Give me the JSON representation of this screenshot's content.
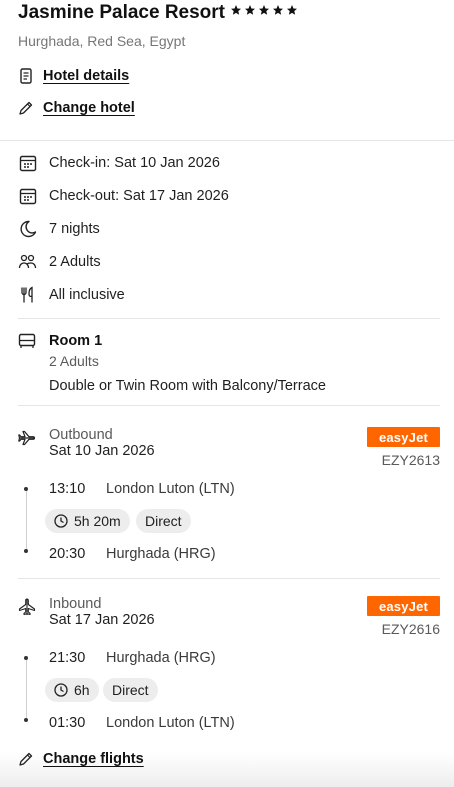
{
  "hotel": {
    "name": "Jasmine Palace Resort",
    "star_rating": 5,
    "location": "Hurghada, Red Sea, Egypt",
    "details_link": "Hotel details",
    "change_hotel_link": "Change hotel",
    "icons": {
      "details": "document-icon",
      "change": "pencil-icon"
    }
  },
  "stay": {
    "check_in": "Check-in: Sat 10 Jan 2026",
    "check_out": "Check-out: Sat 17 Jan 2026",
    "nights": "7 nights",
    "guests": "2 Adults",
    "board": "All inclusive"
  },
  "room": {
    "title": "Room 1",
    "guests": "2 Adults",
    "description": "Double or Twin Room with Balcony/Terrace"
  },
  "flights": {
    "outbound": {
      "label": "Outbound",
      "date": "Sat 10 Jan 2026",
      "airline": "easyJet",
      "flight_number": "EZY2613",
      "departure_time": "13:10",
      "departure_airport": "London Luton (LTN)",
      "duration": "5h 20m",
      "stops": "Direct",
      "arrival_time": "20:30",
      "arrival_airport": "Hurghada (HRG)"
    },
    "inbound": {
      "label": "Inbound",
      "date": "Sat 17 Jan 2026",
      "airline": "easyJet",
      "flight_number": "EZY2616",
      "departure_time": "21:30",
      "departure_airport": "Hurghada (HRG)",
      "duration": "6h",
      "stops": "Direct",
      "arrival_time": "01:30",
      "arrival_airport": "London Luton (LTN)"
    },
    "change_flights_link": "Change flights"
  },
  "colors": {
    "airline_brand": "#ff6600",
    "pill_bg": "#ededed",
    "divider": "#e6e6e6"
  }
}
